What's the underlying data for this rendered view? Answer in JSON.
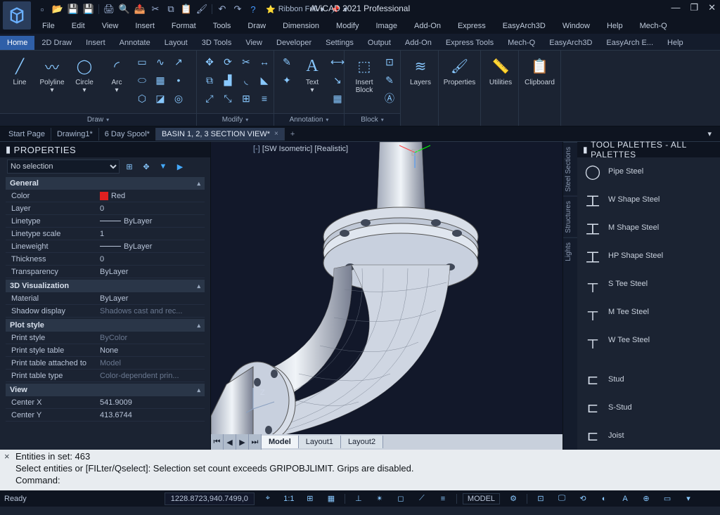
{
  "app": {
    "title": "AViCAD 2021 Professional",
    "ribbon_style": "Ribbon Full"
  },
  "menubar": [
    "File",
    "Edit",
    "View",
    "Insert",
    "Format",
    "Tools",
    "Draw",
    "Dimension",
    "Modify",
    "Image",
    "Add-On",
    "Express",
    "EasyArch3D",
    "Window",
    "Help",
    "Mech-Q"
  ],
  "ribbontabs": [
    "Home",
    "2D Draw",
    "Insert",
    "Annotate",
    "Layout",
    "3D Tools",
    "View",
    "Developer",
    "Settings",
    "Output",
    "Add-On",
    "Express Tools",
    "Mech-Q",
    "EasyArch3D",
    "EasyArch E...",
    "Help"
  ],
  "ribbon_active": "Home",
  "panels": {
    "draw": {
      "label": "Draw",
      "items": [
        "Line",
        "Polyline",
        "Circle",
        "Arc"
      ]
    },
    "modify": {
      "label": "Modify"
    },
    "annotation": {
      "label": "Annotation",
      "text": "Text"
    },
    "block": {
      "label": "Block",
      "insert": "Insert\nBlock"
    },
    "layers": "Layers",
    "properties": "Properties",
    "utilities": "Utilities",
    "clipboard": "Clipboard"
  },
  "doctabs": [
    {
      "label": "Start Page",
      "active": false
    },
    {
      "label": "Drawing1*",
      "active": false
    },
    {
      "label": "6 Day Spool*",
      "active": false
    },
    {
      "label": "BASIN 1, 2, 3 SECTION VIEW*",
      "active": true
    }
  ],
  "properties": {
    "title": "PROPERTIES",
    "selection": "No selection",
    "groups": [
      {
        "name": "General",
        "rows": [
          {
            "k": "Color",
            "v": "Red",
            "color": true
          },
          {
            "k": "Layer",
            "v": "0"
          },
          {
            "k": "Linetype",
            "v": "ByLayer",
            "line": true
          },
          {
            "k": "Linetype scale",
            "v": "1"
          },
          {
            "k": "Lineweight",
            "v": "ByLayer",
            "line": true
          },
          {
            "k": "Thickness",
            "v": "0"
          },
          {
            "k": "Transparency",
            "v": "ByLayer"
          }
        ]
      },
      {
        "name": "3D Visualization",
        "rows": [
          {
            "k": "Material",
            "v": "ByLayer"
          },
          {
            "k": "Shadow display",
            "v": "Shadows cast and rec...",
            "dim": true
          }
        ]
      },
      {
        "name": "Plot style",
        "rows": [
          {
            "k": "Print style",
            "v": "ByColor",
            "dim": true
          },
          {
            "k": "Print style table",
            "v": "None"
          },
          {
            "k": "Print table attached to",
            "v": "Model",
            "dim": true
          },
          {
            "k": "Print table type",
            "v": "Color-dependent prin...",
            "dim": true
          }
        ]
      },
      {
        "name": "View",
        "rows": [
          {
            "k": "Center X",
            "v": "541.9009"
          },
          {
            "k": "Center Y",
            "v": "413.6744"
          }
        ]
      }
    ]
  },
  "viewport": {
    "label_left": "[SW Isometric]",
    "label_right": "[Realistic]",
    "axis_z": "Z",
    "layouts": [
      "Model",
      "Layout1",
      "Layout2"
    ],
    "layout_active": "Model"
  },
  "palettes": {
    "title": "TOOL PALETTES - ALL PALETTES",
    "tabs": [
      "Steel Sections",
      "Structures",
      "Lights"
    ],
    "items": [
      "Pipe Steel",
      "W Shape Steel",
      "M Shape Steel",
      "HP Shape Steel",
      "S Tee Steel",
      "M Tee Steel",
      "W Tee Steel",
      "Stud",
      "S-Stud",
      "Joist"
    ]
  },
  "cmd": {
    "line1": "Entities in set: 463",
    "line2": "Select entities or [FILter/Qselect]: Selection set count exceeds GRIPOBJLIMIT. Grips are disabled.",
    "line3": "Command:"
  },
  "status": {
    "ready": "Ready",
    "coords": "1228.8723,940.7499,0",
    "scale": "1:1",
    "model": "MODEL"
  }
}
